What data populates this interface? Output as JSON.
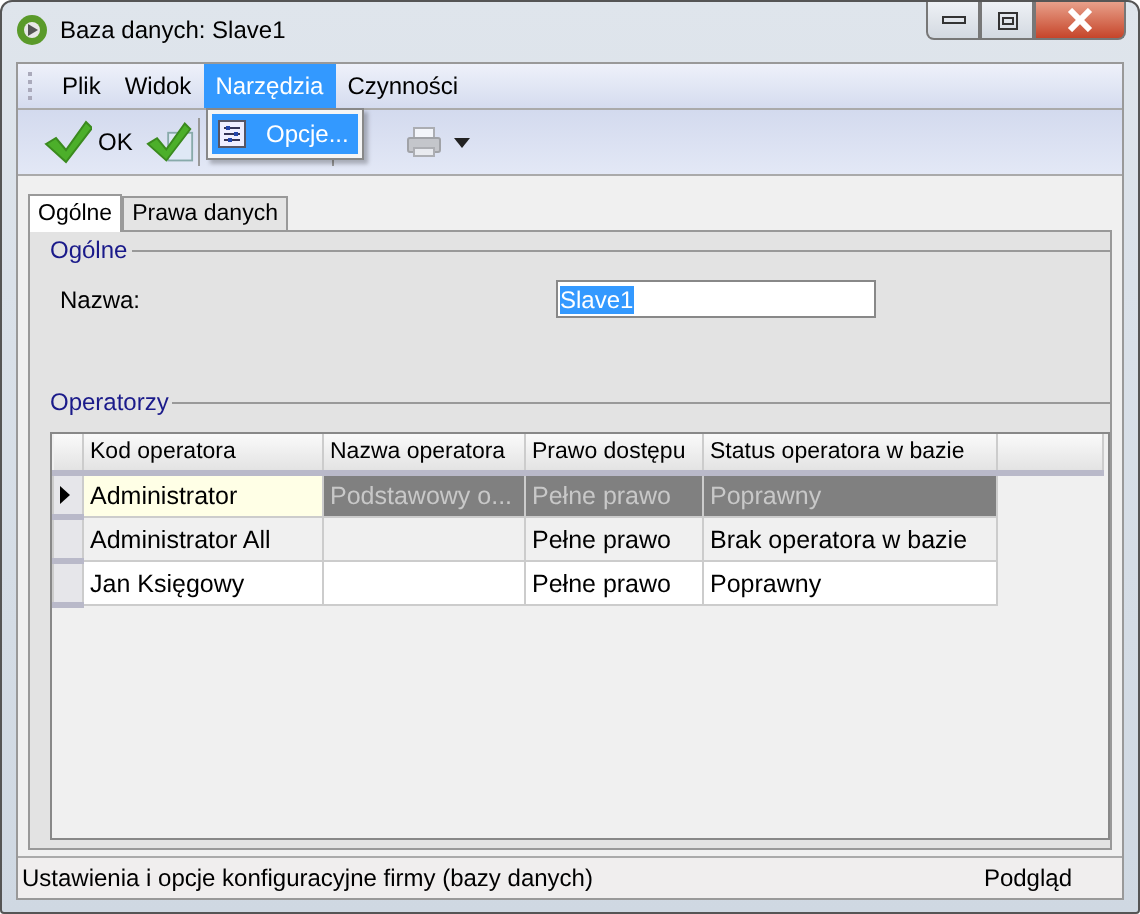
{
  "window": {
    "title": "Baza danych: Slave1"
  },
  "menu": [
    {
      "label": "Plik",
      "selected": false
    },
    {
      "label": "Widok",
      "selected": false
    },
    {
      "label": "Narzędzia",
      "selected": true
    },
    {
      "label": "Czynności",
      "selected": false
    }
  ],
  "dropdown": {
    "items": [
      {
        "label": "Opcje...",
        "selected": true
      }
    ]
  },
  "toolbar": {
    "ok_label": "OK"
  },
  "tabs": [
    {
      "label": "Ogólne",
      "selected": true
    },
    {
      "label": "Prawa danych",
      "selected": false
    }
  ],
  "general": {
    "title": "Ogólne",
    "name_label": "Nazwa:",
    "name_value": "Slave1"
  },
  "operators": {
    "title": "Operatorzy",
    "columns": [
      "Kod operatora",
      "Nazwa operatora",
      "Prawo dostępu",
      "Status operatora w bazie"
    ],
    "rows": [
      {
        "cells": [
          "Administrator",
          "Podstawowy o...",
          "Pełne prawo",
          "Poprawny"
        ],
        "selected": true
      },
      {
        "cells": [
          "Administrator All",
          "",
          "Pełne prawo",
          "Brak operatora w bazie"
        ],
        "selected": false
      },
      {
        "cells": [
          "Jan Księgowy",
          "",
          "Pełne prawo",
          "Poprawny"
        ],
        "selected": false
      }
    ]
  },
  "status_bar": {
    "message": "Ustawienia i opcje konfiguracyjne firmy (bazy danych)",
    "mode": "Podgląd"
  }
}
